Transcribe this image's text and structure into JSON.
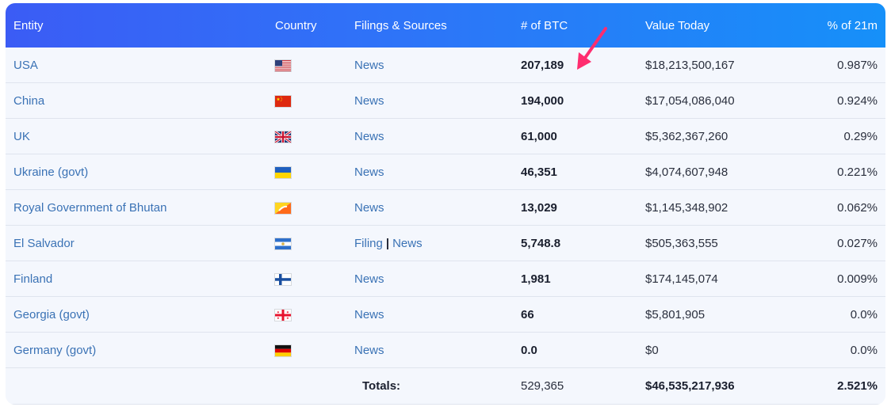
{
  "header": {
    "entity": "Entity",
    "country": "Country",
    "filings": "Filings & Sources",
    "btc": "# of BTC",
    "value": "Value Today",
    "pct": "% of 21m"
  },
  "rows": [
    {
      "entity": "USA",
      "flag": "flag-usa-icon",
      "filings": [
        "News"
      ],
      "btc": "207,189",
      "value": "$18,213,500,167",
      "pct": "0.987%"
    },
    {
      "entity": "China",
      "flag": "flag-china-icon",
      "filings": [
        "News"
      ],
      "btc": "194,000",
      "value": "$17,054,086,040",
      "pct": "0.924%"
    },
    {
      "entity": "UK",
      "flag": "flag-uk-icon",
      "filings": [
        "News"
      ],
      "btc": "61,000",
      "value": "$5,362,367,260",
      "pct": "0.29%"
    },
    {
      "entity": "Ukraine (govt)",
      "flag": "flag-ukraine-icon",
      "filings": [
        "News"
      ],
      "btc": "46,351",
      "value": "$4,074,607,948",
      "pct": "0.221%"
    },
    {
      "entity": "Royal Government of Bhutan",
      "flag": "flag-bhutan-icon",
      "filings": [
        "News"
      ],
      "btc": "13,029",
      "value": "$1,145,348,902",
      "pct": "0.062%"
    },
    {
      "entity": "El Salvador",
      "flag": "flag-el-salvador-icon",
      "filings": [
        "Filing",
        "News"
      ],
      "btc": "5,748.8",
      "value": "$505,363,555",
      "pct": "0.027%"
    },
    {
      "entity": "Finland",
      "flag": "flag-finland-icon",
      "filings": [
        "News"
      ],
      "btc": "1,981",
      "value": "$174,145,074",
      "pct": "0.009%"
    },
    {
      "entity": "Georgia (govt)",
      "flag": "flag-georgia-icon",
      "filings": [
        "News"
      ],
      "btc": "66",
      "value": "$5,801,905",
      "pct": "0.0%"
    },
    {
      "entity": "Germany (govt)",
      "flag": "flag-germany-icon",
      "filings": [
        "News"
      ],
      "btc": "0.0",
      "value": "$0",
      "pct": "0.0%"
    }
  ],
  "totals": {
    "label": "Totals:",
    "btc": "529,365",
    "value": "$46,535,217,936",
    "pct": "2.521%"
  },
  "separator": "|",
  "colors": {
    "header_start": "#3b5cf5",
    "header_end": "#1690f9",
    "link": "#3a72b5",
    "row_bg": "#f4f7fd",
    "arrow": "#ff2d6f"
  },
  "annotation_icon": "pointer-arrow-icon"
}
